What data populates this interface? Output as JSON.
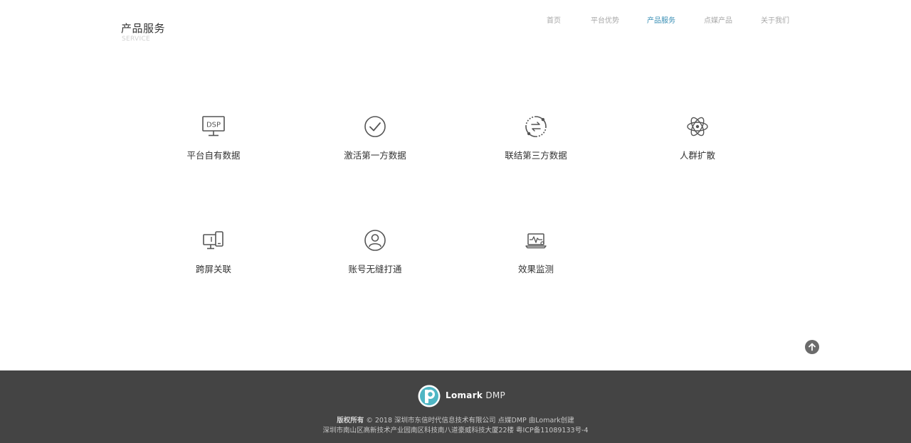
{
  "header": {
    "title": "产品服务",
    "subtitle": "SERVICE"
  },
  "nav": {
    "items": [
      {
        "label": "首页"
      },
      {
        "label": "平台优势"
      },
      {
        "label": "产品服务",
        "active": true
      },
      {
        "label": "点媒产品"
      },
      {
        "label": "关于我们"
      }
    ]
  },
  "services": [
    {
      "label": "平台自有数据",
      "icon": "dsp-monitor-icon",
      "icon_text": "DSP"
    },
    {
      "label": "激活第一方数据",
      "icon": "check-circle-icon"
    },
    {
      "label": "联结第三方数据",
      "icon": "sync-link-icon"
    },
    {
      "label": "人群扩散",
      "icon": "atom-icon"
    },
    {
      "label": "跨屏关联",
      "icon": "multi-screen-icon"
    },
    {
      "label": "账号无缝打通",
      "icon": "user-circle-icon"
    },
    {
      "label": "效果监测",
      "icon": "laptop-pulse-icon"
    }
  ],
  "footer": {
    "logo_name": "Lomark",
    "logo_suffix": "DMP",
    "copyright_bold": "版权所有",
    "copyright_text": "© 2018 深圳市东信时代信息技术有限公司    点媒DMP 由Lomark创建",
    "address": "深圳市南山区高新技术产业园南区科技南八道豪威科技大厦22楼     粤ICP备11089133号-4"
  },
  "colors": {
    "accent": "#3a8fb5",
    "footer_bg": "#444444",
    "logo_teal": "#4fb6c4"
  }
}
